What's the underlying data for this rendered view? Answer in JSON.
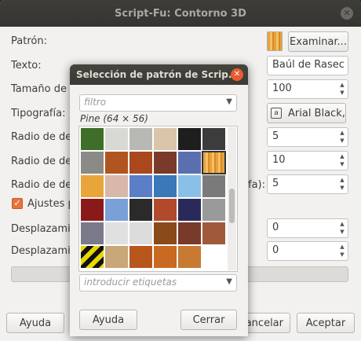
{
  "main": {
    "title": "Script-Fu: Contorno 3D",
    "labels": {
      "pattern": "Patrón:",
      "text": "Texto:",
      "font_size": "Tamaño de la",
      "font": "Tipografía:",
      "radius1": "Radio de des",
      "radius2": "Radio de des",
      "radius3": "Radio de des",
      "radius3_suffix": "fa):",
      "adjustments": "Ajustes p",
      "offset1": "Desplazamie",
      "offset2": "Desplazamie"
    },
    "browse_button": "Examinar...",
    "text_value": "Baúl de Rasec",
    "font_size_value": "100",
    "font_button": "Arial Black,",
    "font_icon_glyph": "a",
    "radius1_value": "5",
    "radius2_value": "10",
    "radius3_value": "5",
    "offset1_value": "0",
    "offset2_value": "0",
    "checkbox_checked": true,
    "help_button": "Ayuda",
    "cancel_button": "ancelar",
    "accept_button": "Aceptar"
  },
  "popup": {
    "title": "Selección de patrón de Scrip...",
    "filter_placeholder": "filtro",
    "pattern_name": "Pine (64 × 56)",
    "tags_placeholder": "introducir etiquetas",
    "help_button": "Ayuda",
    "close_button": "Cerrar",
    "selected_index": 11,
    "patterns": [
      "#3f6e2a",
      "#d8d8d4",
      "#b8b8b4",
      "#d9c5a8",
      "#1e1e1e",
      "#3c3c3c",
      "#8a8a86",
      "#b0551f",
      "#a8481c",
      "#7a3a2a",
      "#5a6fb0",
      "#e9a23b",
      "#e8a53a",
      "#d8b8a8",
      "#5a7ec8",
      "#3a78b8",
      "#8ac0e8",
      "#7a7a7a",
      "#8a1a1a",
      "#7aa0d8",
      "#2a2a2a",
      "#b04a2a",
      "#2a2a5a",
      "#9a9a9a",
      "#7a7a8a",
      "#e0e0e0",
      "#dcdcdc",
      "#8a4a1a",
      "#7a3a2a",
      "#a05a3a",
      "#e8d800",
      "#c8a878",
      "#b8561c",
      "#c86a22",
      "#c87a32",
      "#ffffff"
    ]
  }
}
